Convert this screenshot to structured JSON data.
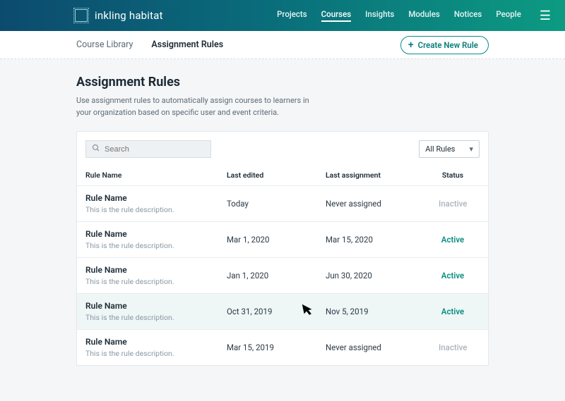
{
  "brand": {
    "name": "inkling habitat"
  },
  "nav": {
    "items": [
      {
        "label": "Projects",
        "active": false
      },
      {
        "label": "Courses",
        "active": true
      },
      {
        "label": "Insights",
        "active": false
      },
      {
        "label": "Modules",
        "active": false
      },
      {
        "label": "Notices",
        "active": false
      },
      {
        "label": "People",
        "active": false
      }
    ]
  },
  "subnav": {
    "items": [
      {
        "label": "Course Library",
        "active": false
      },
      {
        "label": "Assignment Rules",
        "active": true
      }
    ],
    "create_label": "Create New Rule"
  },
  "page": {
    "title": "Assignment Rules",
    "description": "Use assignment rules to automatically assign courses to learners in your organization based on specific user and event criteria."
  },
  "toolbar": {
    "search_placeholder": "Search",
    "filter_label": "All Rules"
  },
  "table": {
    "columns": {
      "name": "Rule Name",
      "edited": "Last edited",
      "assigned": "Last assignment",
      "status": "Status"
    },
    "rows": [
      {
        "name": "Rule Name",
        "desc": "This is the rule description.",
        "edited": "Today",
        "assigned": "Never assigned",
        "status": "Inactive",
        "hover": false
      },
      {
        "name": "Rule Name",
        "desc": "This is the rule description.",
        "edited": "Mar  1, 2020",
        "assigned": "Mar 15, 2020",
        "status": "Active",
        "hover": false
      },
      {
        "name": "Rule Name",
        "desc": "This is the rule description.",
        "edited": "Jan 1, 2020",
        "assigned": "Jun 30, 2020",
        "status": "Active",
        "hover": false
      },
      {
        "name": "Rule Name",
        "desc": "This is the rule description.",
        "edited": "Oct 31, 2019",
        "assigned": "Nov 5, 2019",
        "status": "Active",
        "hover": true
      },
      {
        "name": "Rule Name",
        "desc": "This is the rule description.",
        "edited": "Mar 15, 2019",
        "assigned": "Never assigned",
        "status": "Inactive",
        "hover": false
      }
    ]
  }
}
